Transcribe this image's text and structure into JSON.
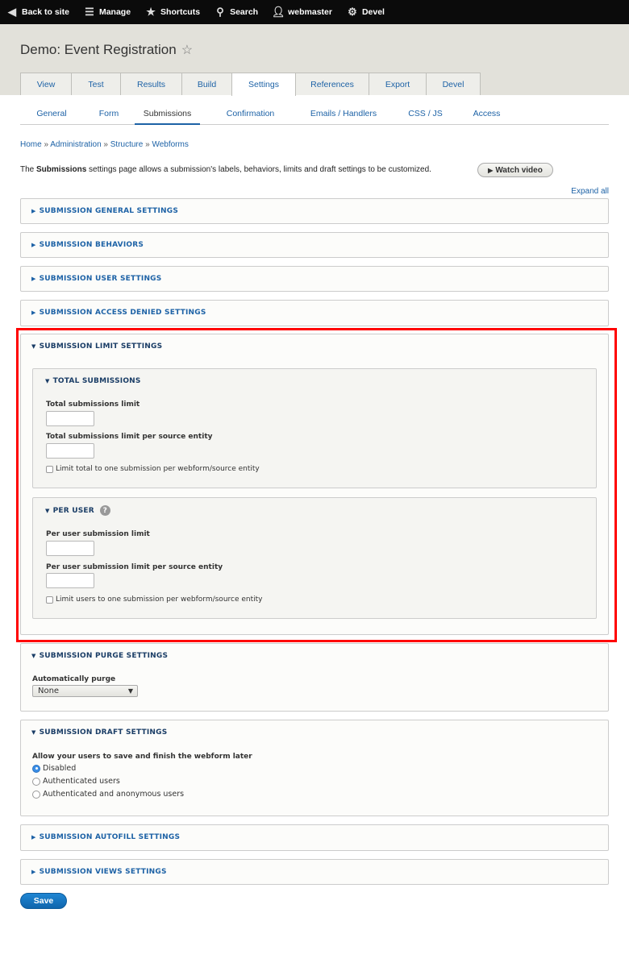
{
  "toolbar": {
    "items": [
      {
        "label": "Back to site",
        "icon": "chevron-left-circle-icon"
      },
      {
        "label": "Manage",
        "icon": "hamburger-icon"
      },
      {
        "label": "Shortcuts",
        "icon": "star-icon"
      },
      {
        "label": "Search",
        "icon": "search-icon"
      },
      {
        "label": "webmaster",
        "icon": "user-icon"
      },
      {
        "label": "Devel",
        "icon": "gear-icon"
      }
    ]
  },
  "header": {
    "title": "Demo: Event Registration",
    "tabs": [
      "View",
      "Test",
      "Results",
      "Build",
      "Settings",
      "References",
      "Export",
      "Devel"
    ],
    "active_tab": "Settings"
  },
  "subtabs": {
    "items": [
      "General",
      "Form",
      "Submissions",
      "Confirmation",
      "Emails / Handlers",
      "CSS / JS",
      "Access"
    ],
    "active": "Submissions"
  },
  "breadcrumb": [
    "Home",
    "Administration",
    "Structure",
    "Webforms"
  ],
  "breadcrumb_sep": "»",
  "description": {
    "prefix": "The ",
    "bold": "Submissions",
    "suffix": " settings page allows a submission's labels, behaviors, limits and draft settings to be customized."
  },
  "watch_video": "Watch video",
  "expand_all": "Expand all",
  "sections": {
    "general": "SUBMISSION GENERAL SETTINGS",
    "behaviors": "SUBMISSION BEHAVIORS",
    "user": "SUBMISSION USER SETTINGS",
    "access_denied": "SUBMISSION ACCESS DENIED SETTINGS",
    "limit": {
      "title": "SUBMISSION LIMIT SETTINGS",
      "total": {
        "title": "TOTAL SUBMISSIONS",
        "limit_label": "Total submissions limit",
        "limit_value": "",
        "entity_label": "Total submissions limit per source entity",
        "entity_value": "",
        "checkbox_label": "Limit total to one submission per webform/source entity",
        "checked": false
      },
      "per_user": {
        "title": "PER USER",
        "help": "?",
        "limit_label": "Per user submission limit",
        "limit_value": "",
        "entity_label": "Per user submission limit per source entity",
        "entity_value": "",
        "checkbox_label": "Limit users to one submission per webform/source entity",
        "checked": false
      }
    },
    "purge": {
      "title": "SUBMISSION PURGE SETTINGS",
      "label": "Automatically purge",
      "value": "None"
    },
    "draft": {
      "title": "SUBMISSION DRAFT SETTINGS",
      "label": "Allow your users to save and finish the webform later",
      "options": [
        "Disabled",
        "Authenticated users",
        "Authenticated and anonymous users"
      ],
      "selected": "Disabled"
    },
    "autofill": "SUBMISSION AUTOFILL SETTINGS",
    "views": "SUBMISSION VIEWS SETTINGS"
  },
  "save_label": "Save",
  "colors": {
    "link": "#1d62a6",
    "highlight_border": "#ff0000",
    "primary_button": "#1874c4"
  }
}
